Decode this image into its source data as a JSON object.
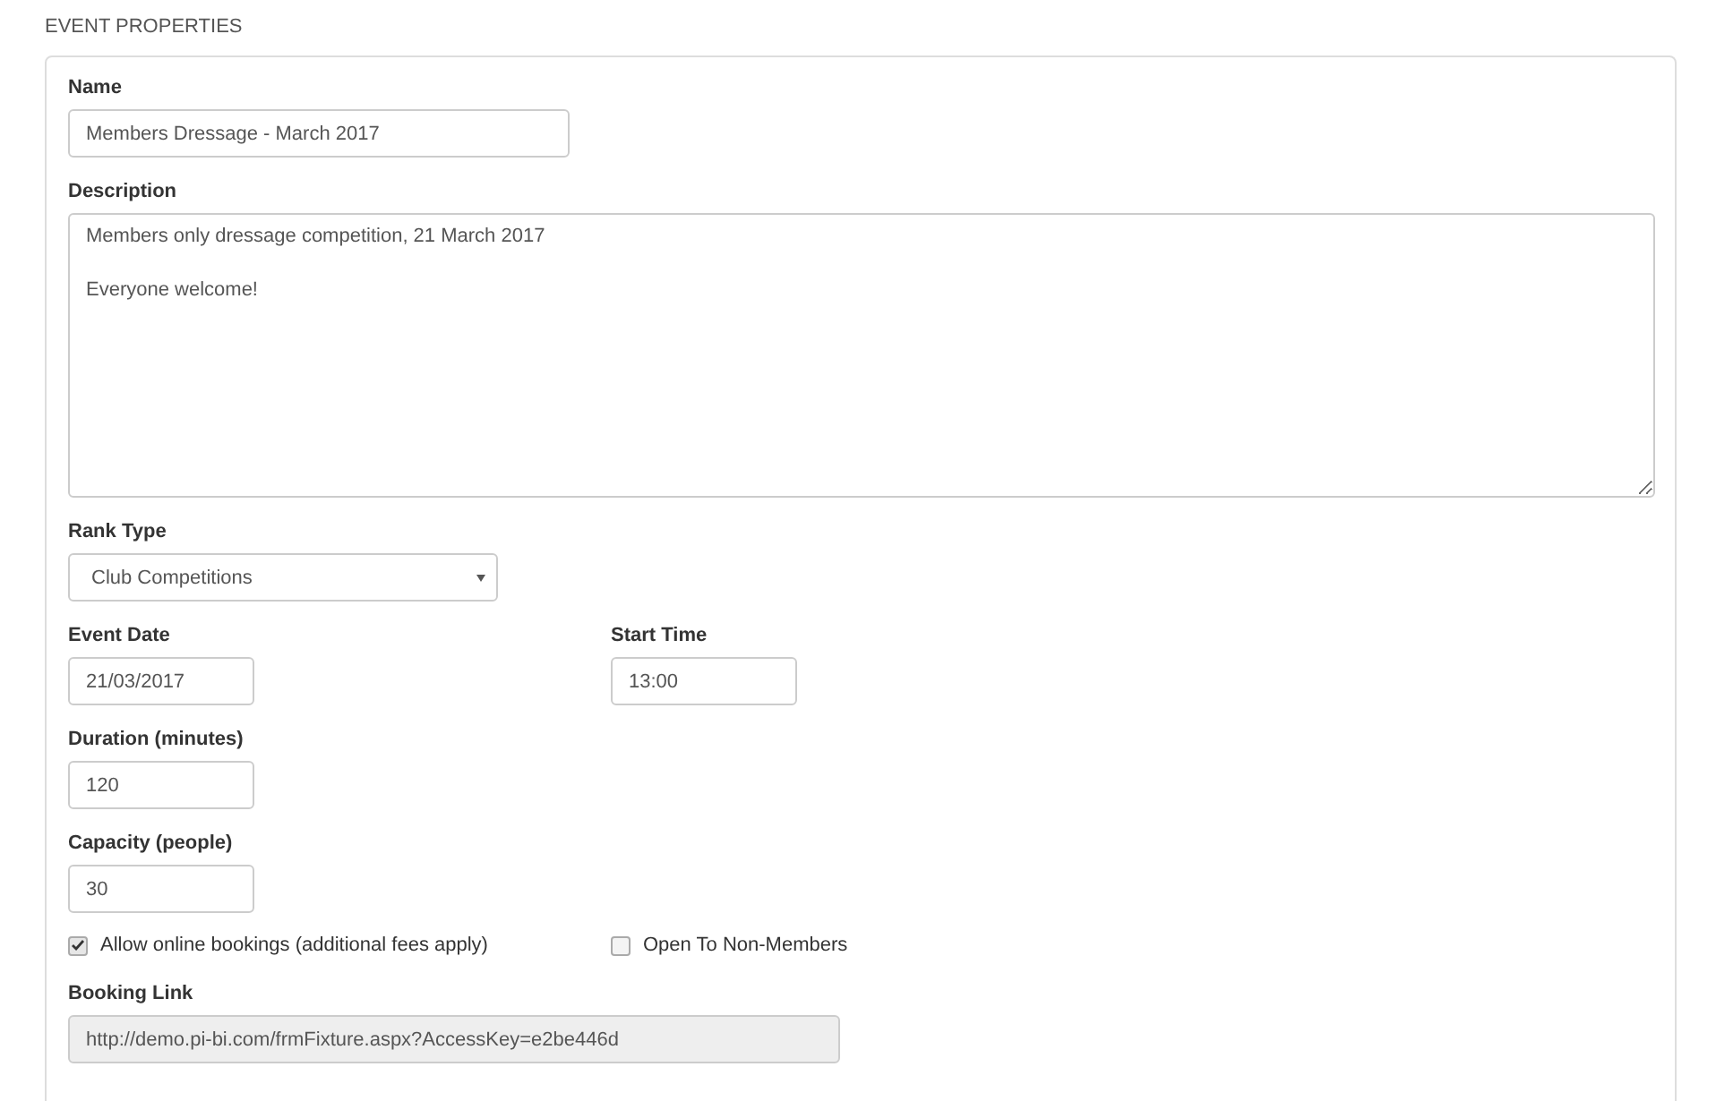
{
  "section_title": "EVENT PROPERTIES",
  "name": {
    "label": "Name",
    "value": "Members Dressage - March 2017"
  },
  "description": {
    "label": "Description",
    "value": "Members only dressage competition, 21 March 2017\n\nEveryone welcome!"
  },
  "rank_type": {
    "label": "Rank Type",
    "value": "Club Competitions"
  },
  "event_date": {
    "label": "Event Date",
    "value": "21/03/2017"
  },
  "start_time": {
    "label": "Start Time",
    "value": "13:00"
  },
  "duration": {
    "label": "Duration (minutes)",
    "value": "120"
  },
  "capacity": {
    "label": "Capacity (people)",
    "value": "30"
  },
  "options": [
    {
      "label": "Allow online bookings (additional fees apply)",
      "checked": true
    },
    {
      "label": "Open To Non-Members",
      "checked": false
    }
  ],
  "booking_link": {
    "label": "Booking Link",
    "value": "http://demo.pi-bi.com/frmFixture.aspx?AccessKey=e2be446d",
    "disabled": true
  }
}
